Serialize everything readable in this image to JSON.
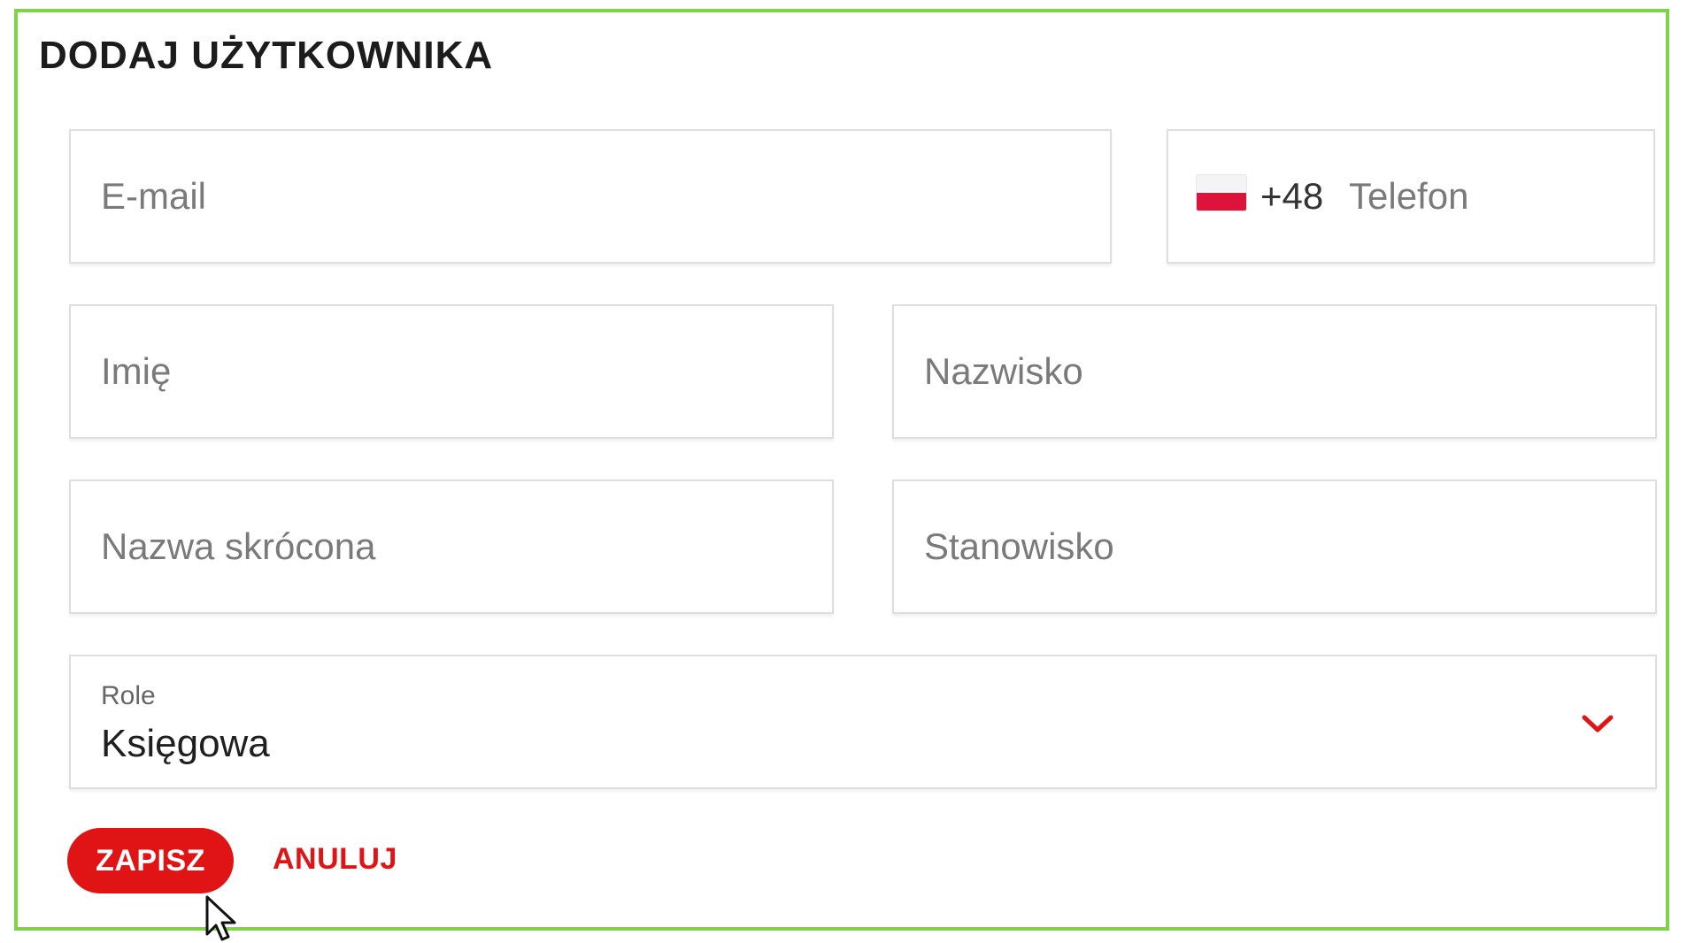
{
  "dialog": {
    "title": "DODAJ UŻYTKOWNIKA"
  },
  "fields": {
    "email": {
      "placeholder": "E-mail"
    },
    "phone": {
      "prefix": "+48",
      "placeholder": "Telefon",
      "flag_icon": "poland-flag-icon"
    },
    "first_name": {
      "placeholder": "Imię"
    },
    "last_name": {
      "placeholder": "Nazwisko"
    },
    "short_name": {
      "placeholder": "Nazwa skrócona"
    },
    "position": {
      "placeholder": "Stanowisko"
    },
    "role": {
      "label": "Role",
      "value": "Księgowa",
      "icon": "chevron-down-icon"
    }
  },
  "actions": {
    "save_label": "ZAPISZ",
    "cancel_label": "ANULUJ"
  },
  "colors": {
    "accent": "#e01414",
    "border_highlight": "#7ed348",
    "flag_red": "#dc143c"
  }
}
